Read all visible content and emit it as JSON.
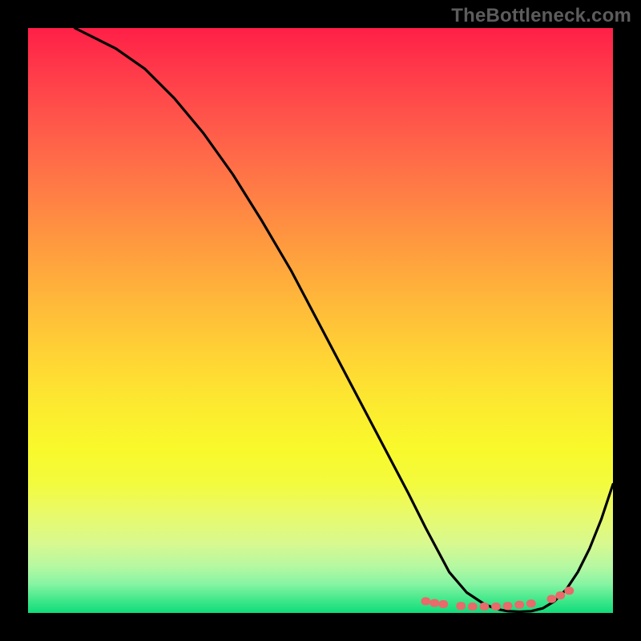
{
  "watermark": "TheBottleneck.com",
  "chart_data": {
    "type": "line",
    "title": "",
    "xlabel": "",
    "ylabel": "",
    "xlim": [
      0,
      100
    ],
    "ylim": [
      0,
      100
    ],
    "grid": false,
    "series": [
      {
        "name": "curve",
        "x": [
          8,
          12,
          15,
          20,
          25,
          30,
          35,
          40,
          45,
          50,
          55,
          60,
          65,
          68,
          72,
          75,
          78,
          80,
          82,
          84,
          86,
          88,
          90,
          92,
          94,
          96,
          98,
          100
        ],
        "y": [
          100,
          98,
          96.5,
          93,
          88,
          82,
          75,
          67,
          58.5,
          49,
          39.5,
          30,
          20.5,
          14.5,
          7,
          3.5,
          1.5,
          0.7,
          0.3,
          0.2,
          0.3,
          0.8,
          2,
          4,
          7,
          11,
          16,
          22
        ]
      }
    ],
    "markers": [
      {
        "x": 68.0,
        "y": 2.0
      },
      {
        "x": 69.5,
        "y": 1.7
      },
      {
        "x": 71.0,
        "y": 1.5
      },
      {
        "x": 74.0,
        "y": 1.2
      },
      {
        "x": 76.0,
        "y": 1.1
      },
      {
        "x": 78.0,
        "y": 1.1
      },
      {
        "x": 80.0,
        "y": 1.1
      },
      {
        "x": 82.0,
        "y": 1.2
      },
      {
        "x": 84.0,
        "y": 1.4
      },
      {
        "x": 86.0,
        "y": 1.6
      },
      {
        "x": 89.5,
        "y": 2.4
      },
      {
        "x": 91.0,
        "y": 3.0
      },
      {
        "x": 92.5,
        "y": 3.8
      }
    ],
    "marker_color": "#e86a6a",
    "line_color": "#000000",
    "background_gradient": {
      "top": "#ff1f47",
      "middle": "#fceb2f",
      "bottom": "#0fdc7a"
    }
  }
}
